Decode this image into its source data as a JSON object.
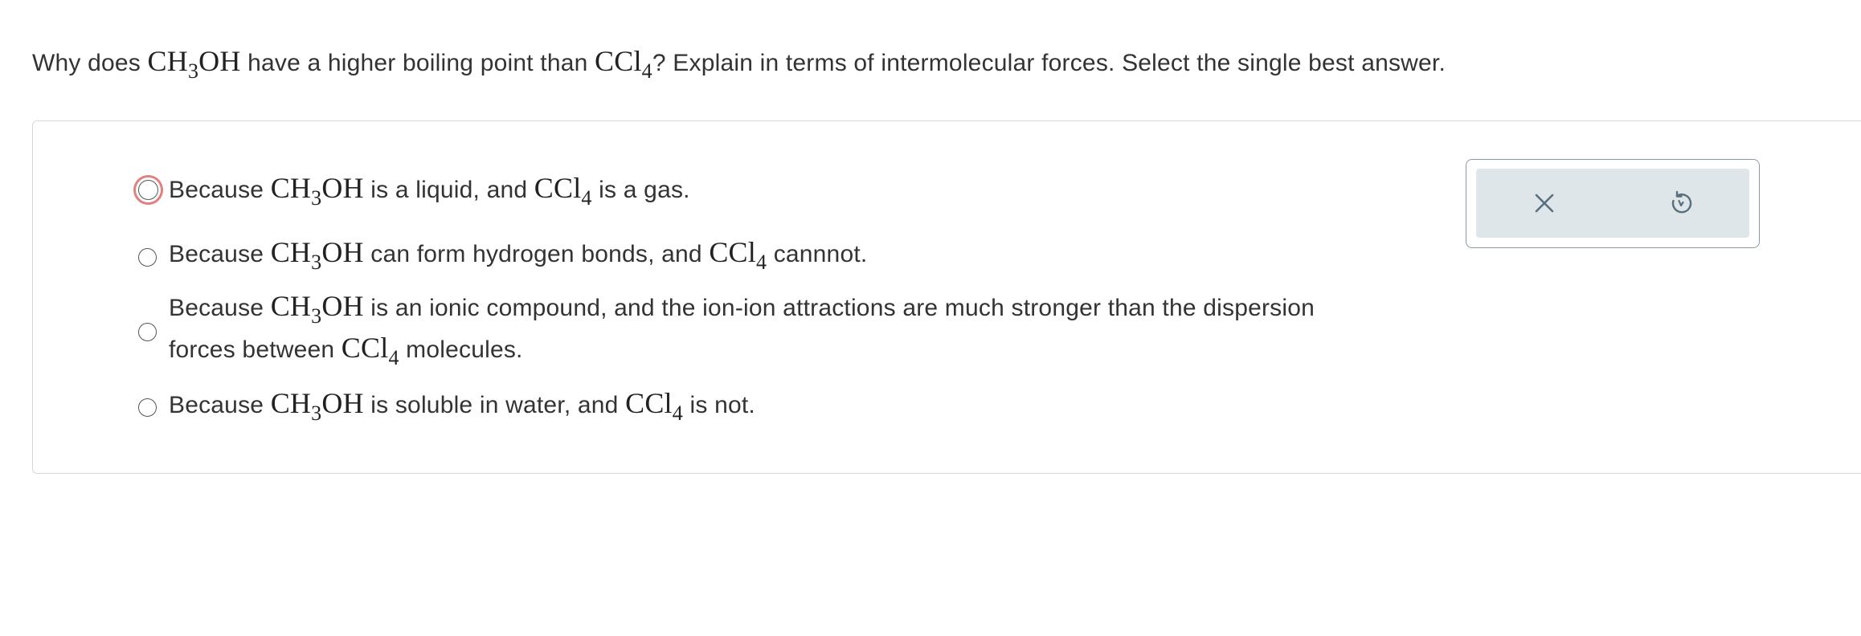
{
  "question": {
    "prefix": "Why does ",
    "formula1_main": "CH",
    "formula1_sub": "3",
    "formula1_tail": "OH",
    "middle": " have a higher boiling point than ",
    "formula2_main": "CCl",
    "formula2_sub": "4",
    "suffix": "? Explain in terms of intermolecular forces. Select the single best answer."
  },
  "options": [
    {
      "a": "Because ",
      "f1_main": "CH",
      "f1_sub": "3",
      "f1_tail": "OH",
      "b": " is a liquid, and ",
      "f2_main": "CCl",
      "f2_sub": "4",
      "c": " is a gas."
    },
    {
      "a": "Because ",
      "f1_main": "CH",
      "f1_sub": "3",
      "f1_tail": "OH",
      "b": " can form hydrogen bonds, and ",
      "f2_main": "CCl",
      "f2_sub": "4",
      "c": " cannnot."
    },
    {
      "a": "Because ",
      "f1_main": "CH",
      "f1_sub": "3",
      "f1_tail": "OH",
      "b": " is an ionic compound, and the ion-ion attractions are much stronger than the dispersion",
      "b2": "forces between ",
      "f2_main": "CCl",
      "f2_sub": "4",
      "c": " molecules."
    },
    {
      "a": "Because ",
      "f1_main": "CH",
      "f1_sub": "3",
      "f1_tail": "OH",
      "b": " is soluble in water, and ",
      "f2_main": "CCl",
      "f2_sub": "4",
      "c": " is not."
    }
  ],
  "toolbox": {
    "clear_icon": "close-icon",
    "undo_icon": "undo-icon",
    "icon_color": "#5a6f7c"
  },
  "colors": {
    "focus_ring": "#e27f7f",
    "toolbox_bg": "#dfe6ea",
    "panel_border": "#d6d6d6"
  }
}
